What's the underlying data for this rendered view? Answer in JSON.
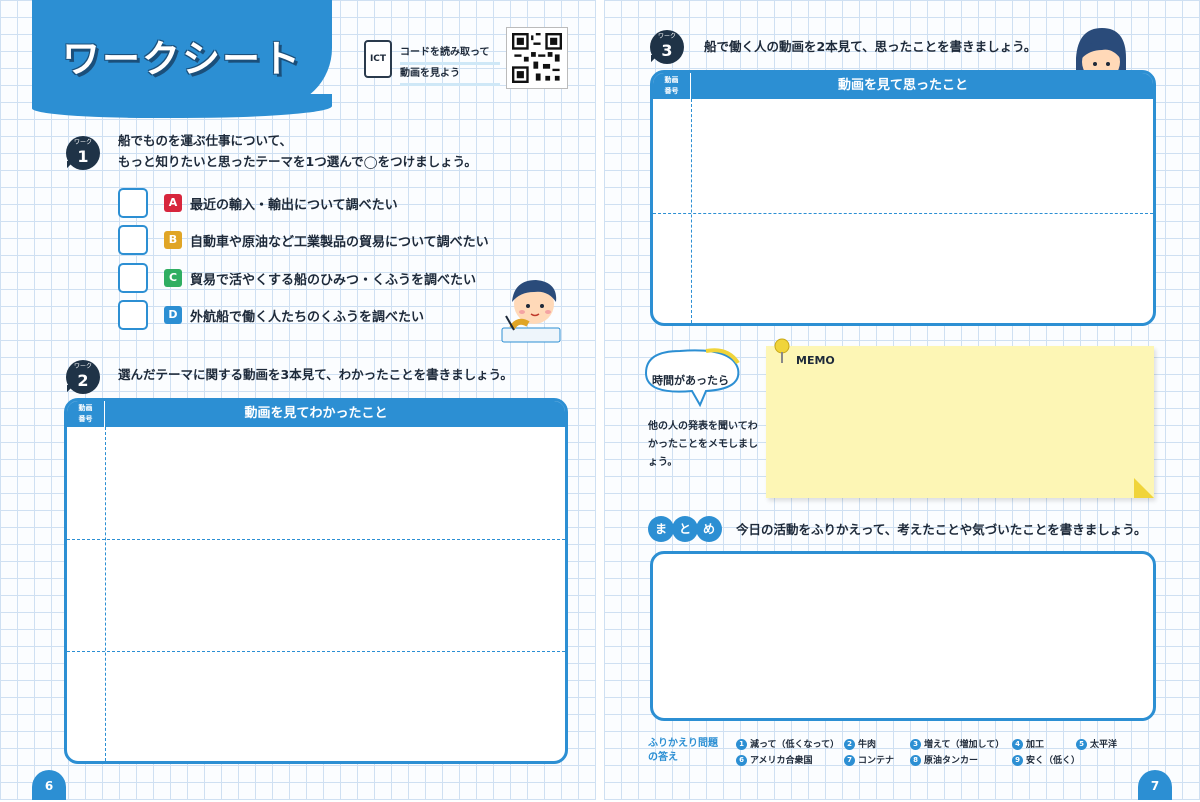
{
  "left_page": {
    "title": "ワークシート",
    "ict": {
      "icon_label": "ICT",
      "line1": "コードを読み取って",
      "line2": "動画を見よう"
    },
    "work1": {
      "badge_small": "ワーク",
      "badge_num": "1",
      "prompt_line1": "船でものを運ぶ仕事について、",
      "prompt_line2": "もっと知りたいと思ったテーマを1つ選んで◯をつけましょう。",
      "options": [
        {
          "letter": "A",
          "text": "最近の輸入・輸出について調べたい",
          "color": "#d7263d"
        },
        {
          "letter": "B",
          "text": "自動車や原油など工業製品の貿易について調べたい",
          "color": "#e0a526"
        },
        {
          "letter": "C",
          "text": "貿易で活やくする船のひみつ・くふうを調べたい",
          "color": "#2fae62"
        },
        {
          "letter": "D",
          "text": "外航船で働く人たちのくふうを調べたい",
          "color": "#2c8fd3"
        }
      ]
    },
    "work2": {
      "badge_small": "ワーク",
      "badge_num": "2",
      "prompt": "選んだテーマに関する動画を3本見て、わかったことを書きましょう。",
      "num_header": "動画番号",
      "table_header": "動画を見てわかったこと"
    },
    "page_number": "6"
  },
  "right_page": {
    "work3": {
      "badge_small": "ワーク",
      "badge_num": "3",
      "prompt": "船で働く人の動画を2本見て、思ったことを書きましょう。",
      "num_header": "動画番号",
      "table_header": "動画を見て思ったこと"
    },
    "time_bubble": "時間があったら",
    "memo_desc": "他の人の発表を聞いてわかったことをメモしましょう。",
    "memo_label": "MEMO",
    "summary": {
      "pills": [
        "ま",
        "と",
        "め"
      ],
      "prompt": "今日の活動をふりかえって、考えたことや気づいたことを書きましょう。"
    },
    "answers": {
      "title_line1": "ふりかえり問題",
      "title_line2": "の答え",
      "items": [
        {
          "n": "1",
          "text": "減って（低くなって）"
        },
        {
          "n": "2",
          "text": "牛肉"
        },
        {
          "n": "3",
          "text": "増えて（増加して）"
        },
        {
          "n": "4",
          "text": "加工"
        },
        {
          "n": "5",
          "text": "太平洋"
        },
        {
          "n": "6",
          "text": "アメリカ合衆国"
        },
        {
          "n": "7",
          "text": "コンテナ"
        },
        {
          "n": "8",
          "text": "原油タンカー"
        },
        {
          "n": "9",
          "text": "安く（低く）"
        }
      ]
    },
    "page_number": "7"
  }
}
